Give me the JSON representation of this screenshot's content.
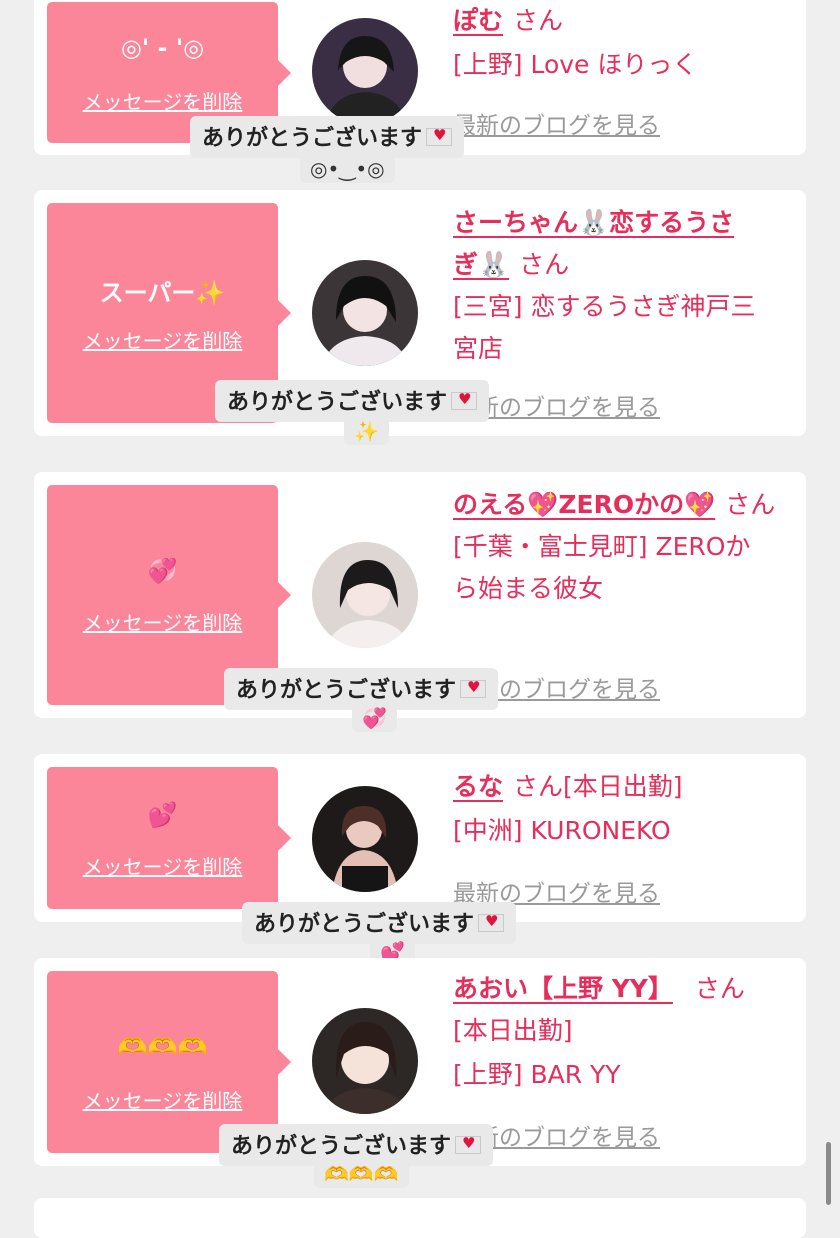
{
  "cards": [
    {
      "message": "◎' - '◎",
      "delete_label": "メッセージを削除",
      "name_line1": "ぽむ",
      "name_line2": "",
      "honorific": "さん",
      "extra": "",
      "shop_line1": "[上野] Love ほりっく",
      "shop_line2": "",
      "blog_label": "最新のブログを見る",
      "reply": "ありがとうございます",
      "reply_emoji": "◎•‿•◎"
    },
    {
      "message": "スーパー✨",
      "delete_label": "メッセージを削除",
      "name_line1": "さーちゃん🐰恋するうさ",
      "name_line2": "ぎ🐰",
      "honorific": "さん",
      "extra": "",
      "shop_line1": "[三宮] 恋するうさぎ神戸三",
      "shop_line2": "宮店",
      "blog_label": "最新のブログを見る",
      "reply": "ありがとうございます",
      "reply_emoji": "✨"
    },
    {
      "message": "💞",
      "delete_label": "メッセージを削除",
      "name_line1": "のえる💖ZEROかの💖",
      "name_line2": "",
      "honorific": "さん",
      "extra": "",
      "shop_line1": "[千葉・富士見町] ZEROか",
      "shop_line2": "ら始まる彼女",
      "blog_label": "最新のブログを見る",
      "reply": "ありがとうございます",
      "reply_emoji": "💞"
    },
    {
      "message": "💕",
      "delete_label": "メッセージを削除",
      "name_line1": "るな",
      "name_line2": "",
      "honorific": "さん",
      "extra": "[本日出勤]",
      "shop_line1": "[中洲] KURONEKO",
      "shop_line2": "",
      "blog_label": "最新のブログを見る",
      "reply": "ありがとうございます",
      "reply_emoji": "💕"
    },
    {
      "message": "🫶🫶🫶",
      "delete_label": "メッセージを削除",
      "name_line1": "あおい【上野 YY】",
      "name_line2": "",
      "honorific": "さん",
      "extra": "[本日出勤]",
      "shop_line1": "[上野] BAR YY",
      "shop_line2": "",
      "blog_label": "最新のブログを見る",
      "reply": "ありがとうございます",
      "reply_emoji": "🫶🫶🫶"
    }
  ],
  "colors": {
    "message_box": "#fb8599",
    "name": "#e62e5c",
    "page_bg": "#efefef"
  }
}
